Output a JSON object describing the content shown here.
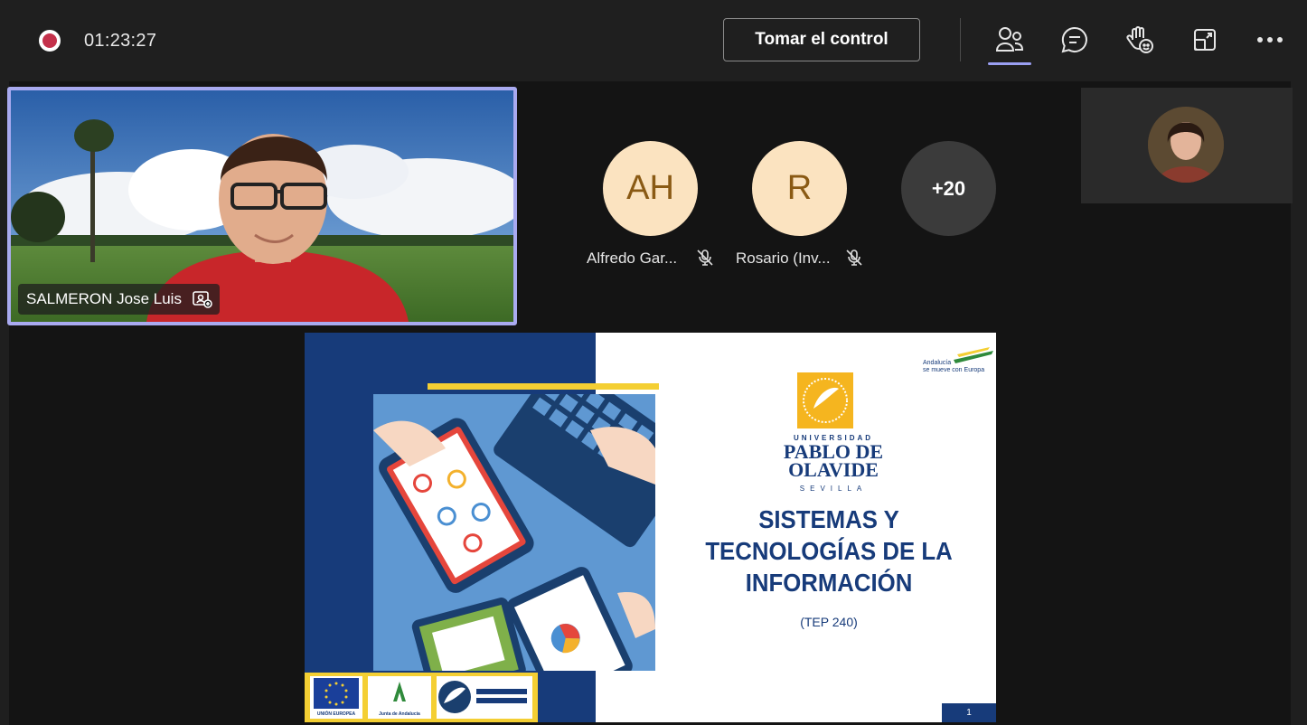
{
  "call": {
    "timer": "01:23:27",
    "take_control_label": "Tomar el control"
  },
  "toolbar": {
    "icons": [
      "people-icon",
      "chat-icon",
      "raise-hand-icon",
      "share-screen-icon",
      "more-icon"
    ]
  },
  "main_participant": {
    "name": "SALMERON Jose Luis"
  },
  "participants": [
    {
      "initials": "AH",
      "name": "Alfredo Gar...",
      "muted": true
    },
    {
      "initials": "R",
      "name": "Rosario (Inv...",
      "muted": true
    }
  ],
  "more_participants": "+20",
  "slide": {
    "title_lines": [
      "SISTEMAS Y",
      "TECNOLOGÍAS DE LA",
      "INFORMACIÓN"
    ],
    "subtitle": "(TEP 240)",
    "university_label": "UNIVERSIDAD",
    "university_name_line1": "PABLO DE",
    "university_name_line2": "OLAVIDE",
    "university_city": "SEVILLA",
    "andalucia_line1": "Andalucía",
    "andalucia_line2": "se mueve con Europa",
    "page_number": "1",
    "footer_logos": [
      "UNIÓN EUROPEA",
      "Junta de Andalucía"
    ]
  },
  "colors": {
    "accent": "#9a9ff2",
    "slide_blue": "#173b7a",
    "slide_yellow": "#f4cf33",
    "record_red": "#c4314b"
  }
}
